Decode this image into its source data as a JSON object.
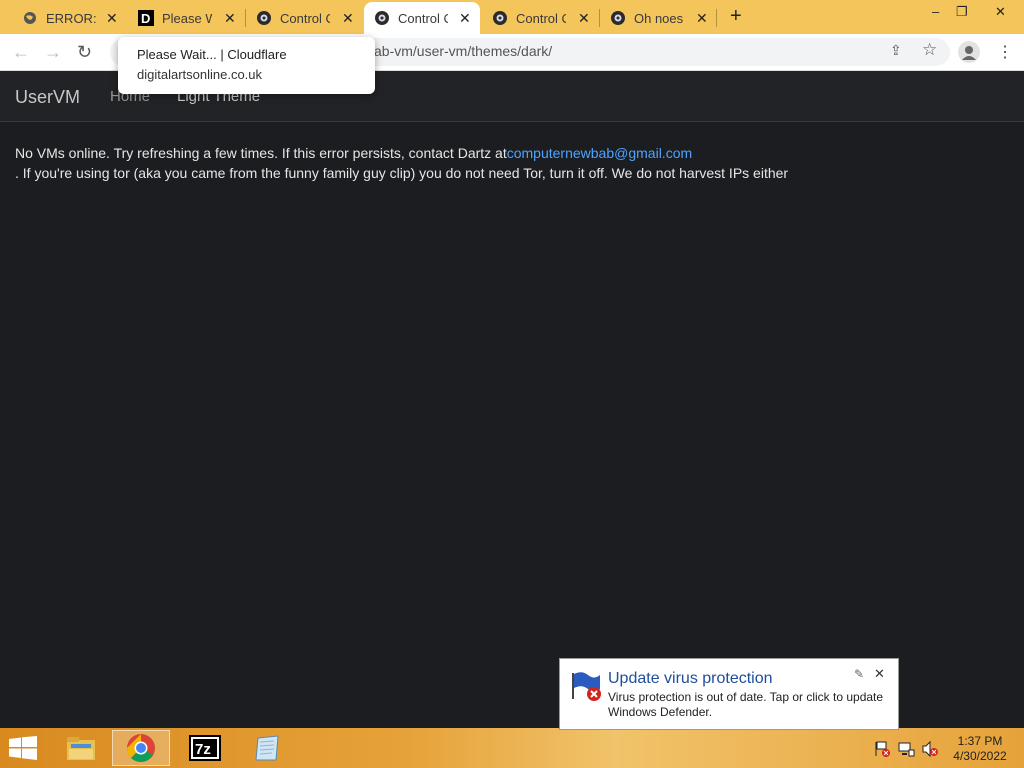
{
  "tabs": [
    {
      "label": "ERROR: Tl",
      "favicon": "globe-icon"
    },
    {
      "label": "Please Wa",
      "favicon": "d-logo-icon"
    },
    {
      "label": "Control C",
      "favicon": "vm-icon"
    },
    {
      "label": "Control C",
      "favicon": "vm-icon",
      "active": true
    },
    {
      "label": "Control C",
      "favicon": "vm-icon"
    },
    {
      "label": "Oh noes!",
      "favicon": "vm-icon"
    }
  ],
  "window_controls": {
    "minimize": "–",
    "restore": "❐",
    "close": "✕"
  },
  "address": {
    "url": "ab-vm/user-vm/themes/dark/"
  },
  "hover_popup": {
    "title": "Please Wait... | Cloudflare",
    "domain": "digitalartsonline.co.uk"
  },
  "site": {
    "brand": "UserVM",
    "nav": [
      {
        "label": "Home"
      },
      {
        "label": "Light Theme"
      }
    ],
    "message_line1": "No VMs online. Try refreshing a few times. If this error persists, contact Dartz at",
    "email": "computernewbab@gmail.com",
    "message_line2": ". If you're using tor (aka you came from the funny family guy clip) you do not need Tor, turn it off. We do not harvest IPs either"
  },
  "notification": {
    "title": "Update virus protection",
    "body": "Virus protection is out of date. Tap or click to update Windows Defender."
  },
  "taskbar": {
    "apps": [
      "start-button",
      "file-explorer",
      "chrome",
      "7zip",
      "notepad"
    ],
    "time": "1:37 PM",
    "date": "4/30/2022"
  },
  "colors": {
    "accent_link": "#4ea3ff",
    "tab_strip": "#f4c55a",
    "page_bg": "#1c1d20"
  }
}
